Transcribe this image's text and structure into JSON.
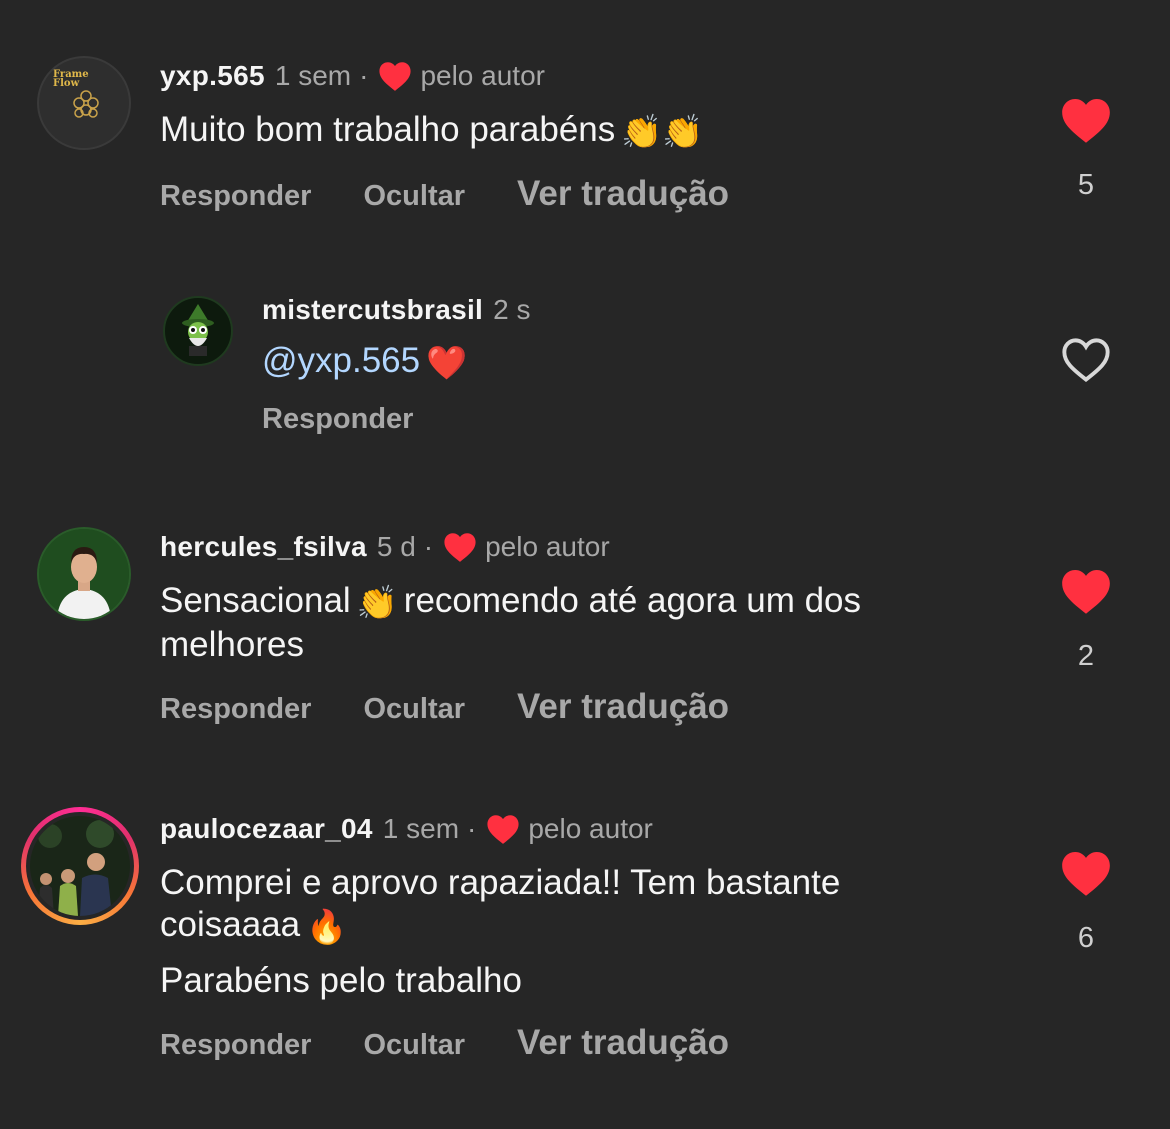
{
  "comments": [
    {
      "username": "yxp.565",
      "time": "1 sem",
      "dot": "·",
      "liked_by_author": "pelo autor",
      "text": "Muito bom trabalho parabéns",
      "emoji": "👏👏",
      "likes": "5",
      "liked": true,
      "avatar_logo": "Frame Flow",
      "actions": {
        "reply": "Responder",
        "hide": "Ocultar",
        "translate": "Ver tradução"
      }
    },
    {
      "username": "mistercutsbrasil",
      "time": "2 s",
      "mention": "@yxp.565",
      "emoji": "❤️",
      "liked": false,
      "actions": {
        "reply": "Responder"
      }
    },
    {
      "username": "hercules_fsilva",
      "time": "5 d",
      "dot": "·",
      "liked_by_author": "pelo autor",
      "text_before": "Sensacional",
      "emoji": "👏",
      "text_after": "recomendo até agora um dos",
      "text_line2": "melhores",
      "likes": "2",
      "liked": true,
      "actions": {
        "reply": "Responder",
        "hide": "Ocultar",
        "translate": "Ver tradução"
      }
    },
    {
      "username": "paulocezaar_04",
      "time": "1 sem",
      "dot": "·",
      "liked_by_author": "pelo autor",
      "text_line1": "Comprei e aprovo rapaziada!! Tem bastante",
      "text_line2": "coisaaaa",
      "emoji": "🔥",
      "text_line3": "Parabéns pelo trabalho",
      "likes": "6",
      "liked": true,
      "actions": {
        "reply": "Responder",
        "hide": "Ocultar",
        "translate": "Ver tradução"
      }
    }
  ],
  "colors": {
    "background": "#262626",
    "heart_red": "#ff3040",
    "muted": "#a8a8a8",
    "mention": "#b3d7ff"
  }
}
